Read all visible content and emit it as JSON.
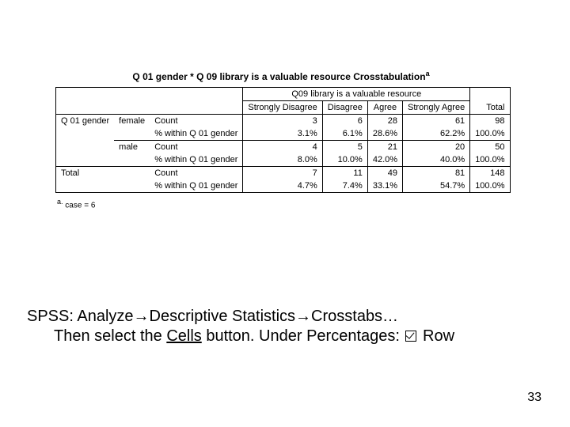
{
  "table": {
    "title_a": "Q 01 gender * Q 09 library is a valuable resource Crosstabulation",
    "title_sup": "a",
    "spanner": "Q09 library is a valuable resource",
    "col_headers": [
      "Strongly Disagree",
      "Disagree",
      "Agree",
      "Strongly Agree"
    ],
    "total_header": "Total",
    "row_var": "Q 01 gender",
    "rows": [
      {
        "group": "female",
        "count_label": "Count",
        "counts": [
          "3",
          "6",
          "28",
          "61",
          "98"
        ],
        "pct_label": "% within Q 01 gender",
        "pcts": [
          "3.1%",
          "6.1%",
          "28.6%",
          "62.2%",
          "100.0%"
        ]
      },
      {
        "group": "male",
        "count_label": "Count",
        "counts": [
          "4",
          "5",
          "21",
          "20",
          "50"
        ],
        "pct_label": "% within Q 01 gender",
        "pcts": [
          "8.0%",
          "10.0%",
          "42.0%",
          "40.0%",
          "100.0%"
        ]
      }
    ],
    "total_row": {
      "label": "Total",
      "count_label": "Count",
      "counts": [
        "7",
        "11",
        "49",
        "81",
        "148"
      ],
      "pct_label": "% within Q 01 gender",
      "pcts": [
        "4.7%",
        "7.4%",
        "33.1%",
        "54.7%",
        "100.0%"
      ]
    },
    "footnote_a": "a.",
    "footnote_text": "case = 6"
  },
  "instruction": {
    "line1_a": "SPSS: Analyze",
    "arrow": "→",
    "line1_b": "Descriptive Statistics",
    "line1_c": "Crosstabs…",
    "line2_a": "Then select the ",
    "cells": "Cells",
    "line2_b": " button. Under Percentages: ",
    "line2_c": " Row"
  },
  "page_number": "33",
  "chart_data": {
    "type": "table",
    "title": "Q 01 gender * Q 09 library is a valuable resource Crosstabulation",
    "columns": [
      "Strongly Disagree",
      "Disagree",
      "Agree",
      "Strongly Agree",
      "Total"
    ],
    "rows": [
      {
        "gender": "female",
        "measure": "Count",
        "values": [
          3,
          6,
          28,
          61,
          98
        ]
      },
      {
        "gender": "female",
        "measure": "% within Q 01 gender",
        "values": [
          3.1,
          6.1,
          28.6,
          62.2,
          100.0
        ]
      },
      {
        "gender": "male",
        "measure": "Count",
        "values": [
          4,
          5,
          21,
          20,
          50
        ]
      },
      {
        "gender": "male",
        "measure": "% within Q 01 gender",
        "values": [
          8.0,
          10.0,
          42.0,
          40.0,
          100.0
        ]
      },
      {
        "gender": "Total",
        "measure": "Count",
        "values": [
          7,
          11,
          49,
          81,
          148
        ]
      },
      {
        "gender": "Total",
        "measure": "% within Q 01 gender",
        "values": [
          4.7,
          7.4,
          33.1,
          54.7,
          100.0
        ]
      }
    ],
    "footnote": "a. case = 6"
  }
}
